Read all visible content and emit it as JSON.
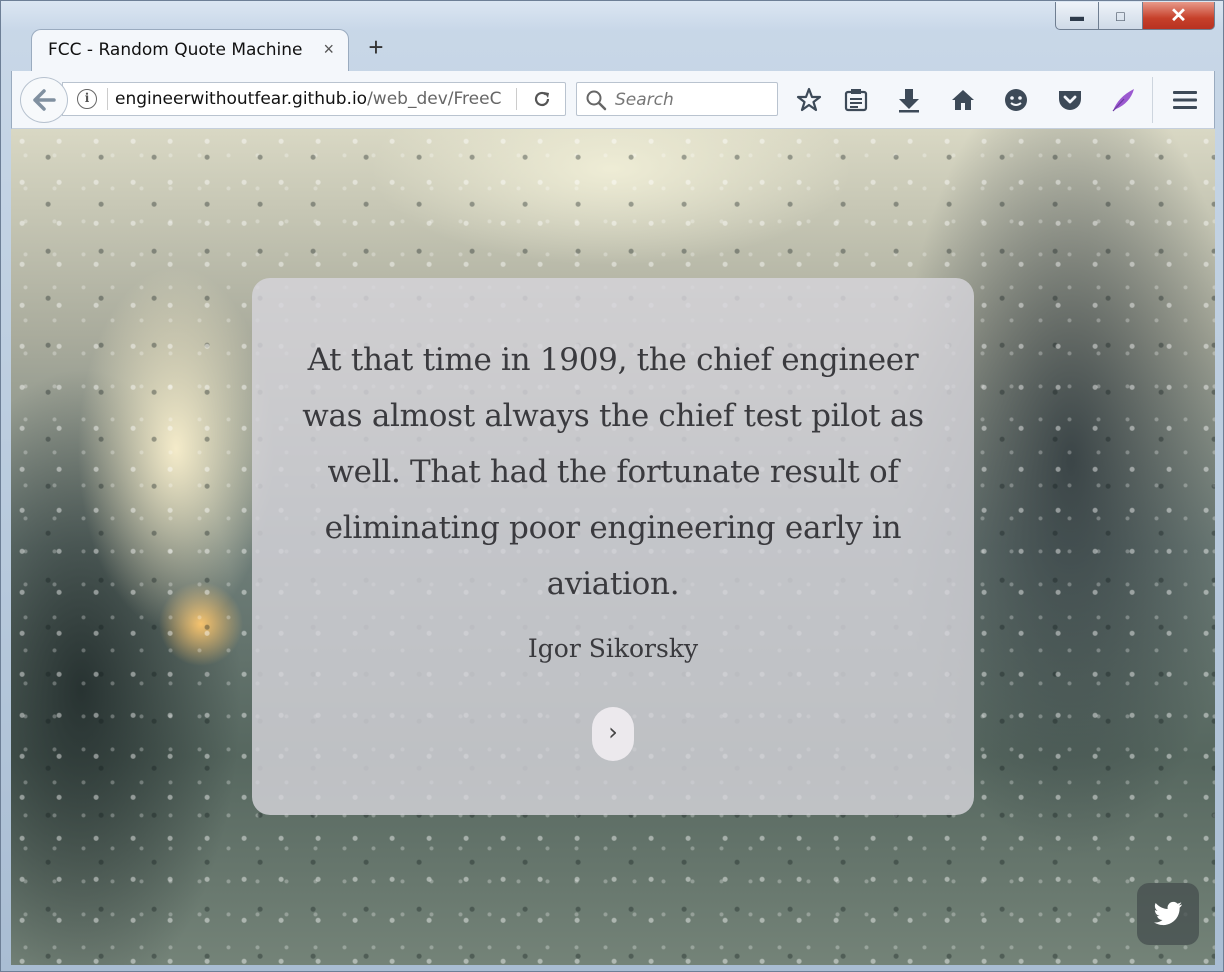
{
  "browser": {
    "tab_title": "FCC - Random Quote Machine",
    "tab_close": "×",
    "new_tab": "+",
    "url_host": "engineerwithoutfear.github.io",
    "url_path": "/web_dev/FreeC",
    "search_placeholder": "Search",
    "window_controls": [
      "minimize-icon",
      "maximize-icon",
      "close-icon"
    ],
    "toolbar_icons": [
      "bookmark-star-icon",
      "reading-list-icon",
      "download-icon",
      "home-icon",
      "smiley-icon",
      "pocket-icon",
      "feather-icon",
      "hamburger-menu-icon"
    ]
  },
  "page": {
    "quote": "At that time in 1909, the chief engineer was almost always the chief test pilot as well. That had the fortunate result of eliminating poor engineering early in aviation.",
    "author": "Igor Sikorsky",
    "next_button_label": "›",
    "twitter_icon": "twitter-icon"
  },
  "colors": {
    "card_background": "#d6d4da",
    "quote_text": "#3a3a3e",
    "feather_accent": "#9b59d0"
  }
}
